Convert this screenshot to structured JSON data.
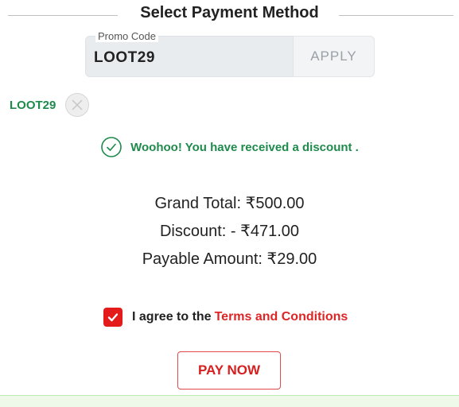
{
  "header": {
    "title": "Select Payment Method"
  },
  "promo": {
    "legend": "Promo Code",
    "value": "LOOT29",
    "apply_label": "APPLY"
  },
  "applied_coupon": {
    "code": "LOOT29",
    "remove_icon": "close-icon"
  },
  "success": {
    "icon": "check-circle-icon",
    "message": "Woohoo! You have received a discount ."
  },
  "totals": {
    "grand_total": "Grand Total: ₹500.00",
    "discount": "Discount: - ₹471.00",
    "payable": "Payable Amount: ₹29.00"
  },
  "agreement": {
    "checked": true,
    "text": "I agree to the",
    "link_text": "Terms and Conditions"
  },
  "pay_button": {
    "label": "PAY NOW"
  },
  "colors": {
    "success_green": "#1e8a4c",
    "accent_red": "#e31b1b",
    "input_bg": "#e9ecef"
  }
}
